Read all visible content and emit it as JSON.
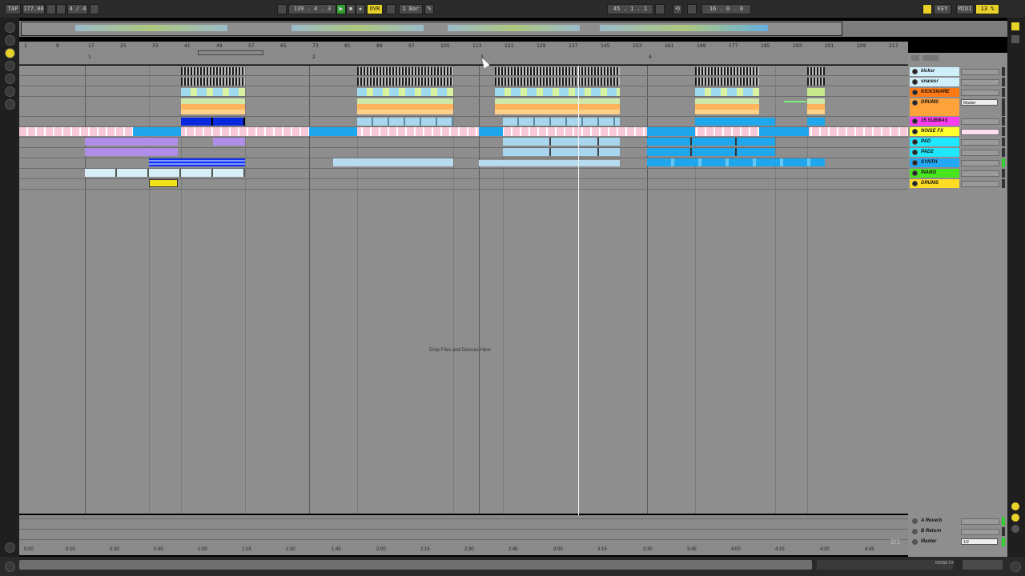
{
  "transport": {
    "tap": "TAP",
    "tempo": "177.00",
    "signature": "4 / 4",
    "position": "139 . 4 . 3",
    "ovr": "OVR",
    "quantize": "1 Bar",
    "loop_start": "45 . 1 . 1",
    "loop_length": "16 . 0 . 0",
    "key": "KEY",
    "midi": "MIDI",
    "cpu": "13 %"
  },
  "ruler": {
    "bars": [
      "1",
      "9",
      "17",
      "25",
      "33",
      "41",
      "49",
      "57",
      "65",
      "73",
      "81",
      "89",
      "97",
      "105",
      "113",
      "121",
      "129",
      "137",
      "145",
      "153",
      "161",
      "169",
      "177",
      "185",
      "193",
      "201",
      "209",
      "217"
    ],
    "markers": [
      "1",
      "2",
      "3",
      "4"
    ]
  },
  "timeline": [
    "0:00",
    "0:15",
    "0:30",
    "0:45",
    "1:00",
    "1:15",
    "1:30",
    "1:45",
    "2:00",
    "2:15",
    "2:30",
    "2:45",
    "3:00",
    "3:15",
    "3:30",
    "3:45",
    "4:00",
    "4:15",
    "4:30",
    "4:45"
  ],
  "drop_text": "Drop Files and Devices Here",
  "tracks": [
    {
      "name": "kicksr",
      "color": "#cfeffb"
    },
    {
      "name": "snaresr",
      "color": "#cfeffb"
    },
    {
      "name": "KICKSNARE",
      "color": "#ff7a14"
    },
    {
      "name": "DRUMS",
      "color": "#ffa23a",
      "routing": "Master"
    },
    {
      "name": "15 SUBBAS",
      "color": "#ff3df0"
    },
    {
      "name": "NOISE FX",
      "color": "#ffff2e"
    },
    {
      "name": "PAD",
      "color": "#1ee7ff"
    },
    {
      "name": "PAD2",
      "color": "#1ee7ff"
    },
    {
      "name": "SYNTH",
      "color": "#22a8f6"
    },
    {
      "name": "PIANO",
      "color": "#48e61c"
    },
    {
      "name": "DRUMS",
      "color": "#ffdd22"
    }
  ],
  "returns": [
    {
      "name": "A Reverb"
    },
    {
      "name": "B Return"
    },
    {
      "name": "Master",
      "routing": "1/2"
    }
  ],
  "page_counter": "2/1",
  "status_right": "NOISE FX"
}
